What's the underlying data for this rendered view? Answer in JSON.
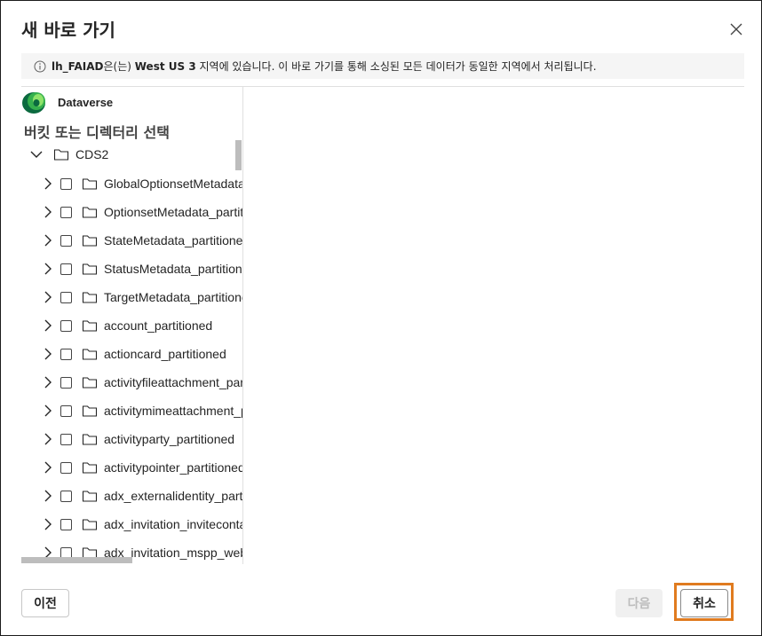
{
  "dialog": {
    "title": "새 바로 가기",
    "close_icon": "close-icon"
  },
  "info": {
    "icon": "info-icon",
    "name": "lh_FAIAD",
    "pre": "은(는) ",
    "region": "West US 3",
    "post": " 지역에 있습니다. 이 바로 가기를 통해 소싱된 모든 데이터가 동일한 지역에서 처리됩니다."
  },
  "source": {
    "icon": "dataverse-logo",
    "label": "Dataverse"
  },
  "tree": {
    "heading": "버킷 또는 디렉터리 선택",
    "root": "CDS2",
    "items": [
      {
        "label": "GlobalOptionsetMetadata"
      },
      {
        "label": "OptionsetMetadata_partitioned"
      },
      {
        "label": "StateMetadata_partitioned"
      },
      {
        "label": "StatusMetadata_partitioned"
      },
      {
        "label": "TargetMetadata_partitioned"
      },
      {
        "label": "account_partitioned"
      },
      {
        "label": "actioncard_partitioned"
      },
      {
        "label": "activityfileattachment_partitioned"
      },
      {
        "label": "activitymimeattachment_partitioned"
      },
      {
        "label": "activityparty_partitioned"
      },
      {
        "label": "activitypointer_partitioned"
      },
      {
        "label": "adx_externalidentity_partitioned"
      },
      {
        "label": "adx_invitation_invitecontacts"
      },
      {
        "label": "adx_invitation_mspp_webrole"
      }
    ]
  },
  "footer": {
    "prev_label": "이전",
    "next_label": "다음",
    "cancel_label": "취소"
  },
  "colors": {
    "highlight": "#e07b1f",
    "info_bg": "#f5f5f5"
  }
}
